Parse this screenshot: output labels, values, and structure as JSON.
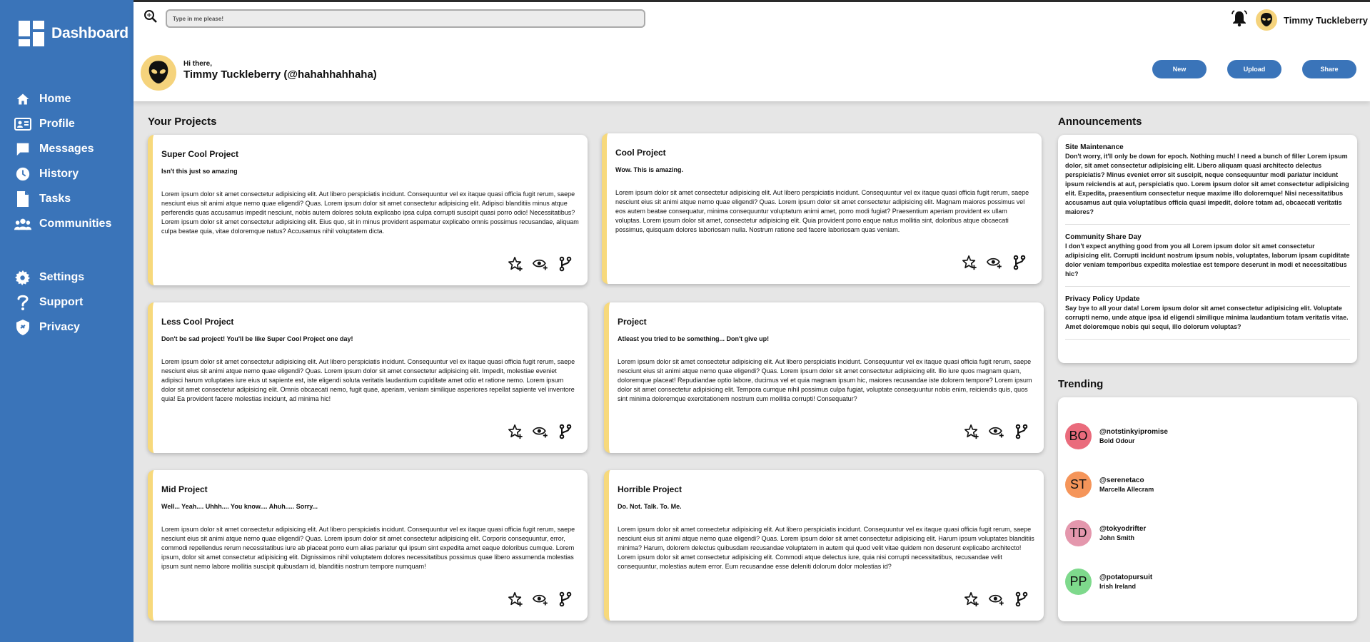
{
  "app": {
    "title": "Dashboard"
  },
  "sidebar": {
    "items": [
      {
        "label": "Home",
        "icon": "home-icon"
      },
      {
        "label": "Profile",
        "icon": "id-card-icon"
      },
      {
        "label": "Messages",
        "icon": "chat-icon"
      },
      {
        "label": "History",
        "icon": "clock-icon"
      },
      {
        "label": "Tasks",
        "icon": "document-icon"
      },
      {
        "label": "Communities",
        "icon": "people-icon"
      }
    ],
    "secondary": [
      {
        "label": "Settings",
        "icon": "gear-icon"
      },
      {
        "label": "Support",
        "icon": "question-icon"
      },
      {
        "label": "Privacy",
        "icon": "shield-icon"
      }
    ]
  },
  "header": {
    "search_placeholder": "Type in me please!",
    "user_name": "Timmy Tuckleberry",
    "greeting": "Hi there,",
    "greeting_name": "Timmy Tuckleberry (@hahahhahhaha)",
    "buttons": {
      "new": "New",
      "upload": "Upload",
      "share": "Share"
    }
  },
  "projects": {
    "title": "Your Projects",
    "items": [
      {
        "title": "Super Cool Project",
        "subtitle": "Isn't this just so amazing",
        "body": "Lorem ipsum dolor sit amet consectetur adipisicing elit. Aut libero perspiciatis incidunt. Consequuntur vel ex itaque quasi officia fugit rerum, saepe nesciunt eius sit animi atque nemo quae eligendi? Quas. Lorem ipsum dolor sit amet consectetur adipisicing elit. Adipisci blanditiis minus atque perferendis quas accusamus impedit nesciunt, nobis autem dolores soluta explicabo ipsa culpa corrupti suscipit quasi porro odio! Necessitatibus? Lorem ipsum dolor sit amet consectetur adipisicing elit. Eius quo, sit in minus provident aspernatur explicabo omnis possimus recusandae, aliquam culpa beatae quia, vitae doloremque natus? Accusamus nihil voluptatem dicta."
      },
      {
        "title": "Cool Project",
        "subtitle": "Wow. This is amazing.",
        "body": "Lorem ipsum dolor sit amet consectetur adipisicing elit. Aut libero perspiciatis incidunt. Consequuntur vel ex itaque quasi officia fugit rerum, saepe nesciunt eius sit animi atque nemo quae eligendi? Quas. Lorem ipsum dolor sit amet consectetur adipisicing elit. Magnam maiores possimus vel eos autem beatae consequatur, minima consequuntur voluptatum animi amet, porro modi fugiat? Praesentium aperiam provident ex ullam voluptas. Lorem ipsum dolor sit amet, consectetur adipisicing elit. Quia provident porro eaque natus mollitia sint, doloribus atque obcaecati possimus, quisquam dolores laboriosam nulla. Nostrum ratione sed facere laboriosam quas veniam."
      },
      {
        "title": "Less Cool Project",
        "subtitle": "Don't be sad project! You'll be like Super Cool Project one day!",
        "body": "Lorem ipsum dolor sit amet consectetur adipisicing elit. Aut libero perspiciatis incidunt. Consequuntur vel ex itaque quasi officia fugit rerum, saepe nesciunt eius sit animi atque nemo quae eligendi? Quas. Lorem ipsum dolor sit amet consectetur adipisicing elit. Impedit, molestiae eveniet adipisci harum voluptates iure eius ut sapiente est, iste eligendi soluta veritatis laudantium cupiditate amet odio et ratione nemo. Lorem ipsum dolor sit amet consectetur adipisicing elit. Omnis obcaecati nemo, fugit quae, aperiam, veniam similique asperiores repellat sapiente vel inventore quia! Ea provident facere molestias incidunt, ad minima hic!"
      },
      {
        "title": "Project",
        "subtitle": "Atleast you tried to be something... Don't give up!",
        "body": "Lorem ipsum dolor sit amet consectetur adipisicing elit. Aut libero perspiciatis incidunt. Consequuntur vel ex itaque quasi officia fugit rerum, saepe nesciunt eius sit animi atque nemo quae eligendi? Quas. Lorem ipsum dolor sit amet consectetur adipisicing elit. Illo iure quos magnam quam, doloremque placeat! Repudiandae optio labore, ducimus vel et quia magnam ipsum hic, maiores recusandae iste dolorem tempore? Lorem ipsum dolor sit amet consectetur adipisicing elit. Tempora cumque nihil possimus culpa fugiat, voluptate consequuntur nobis enim, reiciendis quis, quos sint minima doloremque exercitationem nostrum cum mollitia corrupti! Consequatur?"
      },
      {
        "title": "Mid Project",
        "subtitle": "Well... Yeah.... Uhhh.... You know.... Ahuh..... Sorry...",
        "body": "Lorem ipsum dolor sit amet consectetur adipisicing elit. Aut libero perspiciatis incidunt. Consequuntur vel ex itaque quasi officia fugit rerum, saepe nesciunt eius sit animi atque nemo quae eligendi? Quas. Lorem ipsum dolor sit amet consectetur adipisicing elit. Corporis consequuntur, error, commodi repellendus rerum necessitatibus iure ab placeat porro eum alias pariatur qui ipsum sint expedita amet eaque doloribus cumque. Lorem ipsum, dolor sit amet consectetur adipisicing elit. Dignissimos nihil voluptatem dolores necessitatibus possimus quae libero assumenda molestias ipsum sunt nemo labore mollitia suscipit quibusdam id, blanditiis nostrum tempore numquam!"
      },
      {
        "title": "Horrible Project",
        "subtitle": "Do. Not. Talk. To. Me.",
        "body": "Lorem ipsum dolor sit amet consectetur adipisicing elit. Aut libero perspiciatis incidunt. Consequuntur vel ex itaque quasi officia fugit rerum, saepe nesciunt eius sit animi atque nemo quae eligendi? Quas. Lorem ipsum dolor sit amet consectetur adipisicing elit. Harum ipsum voluptates blanditiis minima? Harum, dolorem delectus quibusdam recusandae voluptatem in autem qui quod velit vitae quidem non deserunt explicabo architecto! Lorem ipsum dolor sit amet consectetur adipisicing elit. Commodi atque delectus iure, quia nisi corrupti necessitatibus, recusandae velit consequuntur, molestias autem error. Eum recusandae esse deleniti dolorum dolor molestias id?"
      }
    ]
  },
  "announcements": {
    "title": "Announcements",
    "items": [
      {
        "title": "Site Maintenance",
        "body": "Don't worry, it'll only be down for epoch. Nothing much! I need a bunch of filler Lorem ipsum dolor, sit amet consectetur adipisicing elit. Libero aliquam quasi architecto delectus perspiciatis? Minus eveniet error sit suscipit, neque consequuntur modi pariatur incidunt ipsum reiciendis at aut, perspiciatis quo. Lorem ipsum dolor sit amet consectetur adipisicing elit. Expedita, praesentium consectetur neque maxime illo doloremque! Nisi necessitatibus accusamus aut quia voluptatibus officia quasi impedit, dolore totam ad, obcaecati veritatis maiores?"
      },
      {
        "title": "Community Share Day",
        "body": "I don't expect anything good from you all Lorem ipsum dolor sit amet consectetur adipisicing elit. Corrupti incidunt nostrum ipsum nobis, voluptates, laborum ipsam cupiditate dolor veniam temporibus expedita molestiae est tempore deserunt in modi et necessitatibus hic?"
      },
      {
        "title": "Privacy Policy Update",
        "body": "Say bye to all your data! Lorem ipsum dolor sit amet consectetur adipisicing elit. Voluptate corrupti nemo, unde atque ipsa id eligendi similique minima laudantium totam veritatis vitae. Amet doloremque nobis qui sequi, illo dolorum voluptas?"
      }
    ]
  },
  "trending": {
    "title": "Trending",
    "items": [
      {
        "initials": "BO",
        "handle": "@notstinkyipromise",
        "name": "Bold Odour",
        "color": "#ea6b7c"
      },
      {
        "initials": "ST",
        "handle": "@serenetaco",
        "name": "Marcella Allecram",
        "color": "#f5955a"
      },
      {
        "initials": "TD",
        "handle": "@tokyodrifter",
        "name": "John Smith",
        "color": "#e497ad"
      },
      {
        "initials": "PP",
        "handle": "@potatopursuit",
        "name": "Irish Ireland",
        "color": "#7ed98c"
      }
    ]
  },
  "colors": {
    "primary": "#3a74b9",
    "accent": "#f7d97c",
    "background": "#e6e6e6"
  }
}
